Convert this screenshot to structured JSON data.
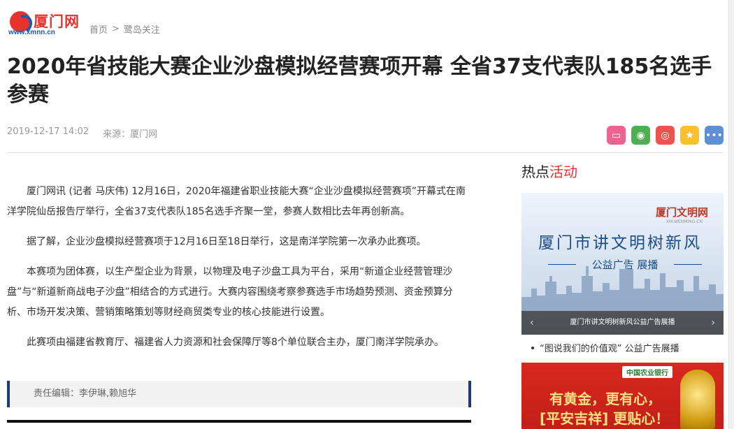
{
  "site": {
    "logo_cn": "厦门网",
    "logo_url": "www.xmnn.cn"
  },
  "breadcrumb": {
    "home": "首页",
    "separator": ">",
    "section": "鹭岛关注"
  },
  "article": {
    "title": "2020年省技能大赛企业沙盘模拟经营赛项开幕 全省37支代表队185名选手参赛",
    "date": "2019-12-17 14:02",
    "source": "来源：厦门网",
    "paragraphs": [
      "厦门网讯 (记者 马庆伟) 12月16日，2020年福建省职业技能大赛“企业沙盘模拟经营赛项”开幕式在南洋学院仙岳报告厅举行，全省37支代表队185名选手齐聚一堂，参赛人数相比去年再创新高。",
      "据了解，企业沙盘模拟经营赛项于12月16日至18日举行，这是南洋学院第一次承办此赛项。",
      "本赛项为团体赛，以生产型企业为背景，以物理及电子沙盘工具为平台，采用“新道企业经营管理沙盘”与“新道新商战电子沙盘”相结合的方式进行。大赛内容围绕考察参赛选手市场趋势预测、资金预算分析、市场开发决策、营销策略策划等财经商贸类专业的核心技能进行设置。",
      "此赛项由福建省教育厅、福建省人力资源和社会保障厅等8个单位联合主办，厦门南洋学院承办。"
    ],
    "editor": "责任编辑：李伊琳,赖旭华"
  },
  "share": {
    "icons": [
      "comment-icon",
      "wechat-icon",
      "weibo-icon",
      "favorite-icon",
      "more-icon"
    ],
    "glyphs": [
      "▭",
      "◉",
      "◎",
      "★",
      "•••"
    ],
    "colors": [
      "#f06292",
      "#4caf50",
      "#ef5350",
      "#fbc02d",
      "#5c8fd6"
    ]
  },
  "sidebar": {
    "title_plain": "热点",
    "title_highlight": "活动",
    "banner1": {
      "brand": "厦门文明网",
      "brand_sub": "XM.WENMING.CN",
      "headline": "厦门市讲文明树新风",
      "sub": "公益广告 展播",
      "caption": "厦门市讲文明树新风公益广告展播",
      "prev": "‹",
      "next": "›"
    },
    "link": "“图说我们的价值观” 公益广告展播",
    "banner2": {
      "bank": "中国农业银行",
      "line1": "有黄金，更有心，",
      "line2": "[平安吉祥] 更贴心！"
    }
  },
  "colors": {
    "accent_red": "#e7332b",
    "brand_blue": "#1f5aa9",
    "editor_border": "#1e3a78"
  }
}
